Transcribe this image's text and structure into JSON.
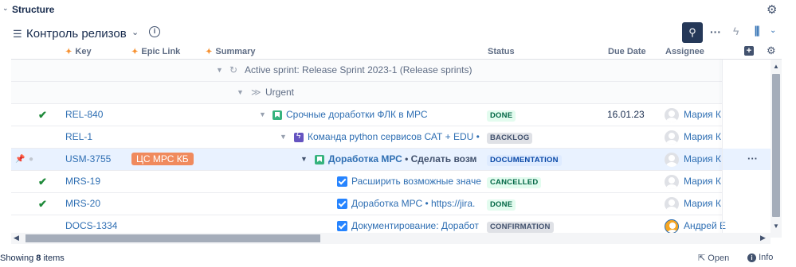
{
  "panel": {
    "title": "Structure"
  },
  "toolbar": {
    "structure_name": "Контроль релизов"
  },
  "columns": {
    "key": "Key",
    "epic": "Epic Link",
    "summary": "Summary",
    "status": "Status",
    "due": "Due Date",
    "assignee": "Assignee"
  },
  "groups": {
    "sprint": "Active sprint: Release Sprint 2023-1 (Release sprints)",
    "priority": "Urgent"
  },
  "rows": [
    {
      "key": "REL-840",
      "summary": "Срочные доработки ФЛК в МРС",
      "status": "DONE",
      "due": "16.01.23",
      "assignee": "Мария К"
    },
    {
      "key": "REL-1",
      "summary": "Команда python сервисов САТ + EDU •",
      "status": "BACKLOG",
      "assignee": "Мария К"
    },
    {
      "key": "USM-3755",
      "epic": "ЦС МРС КБ",
      "summary": "Доработка МРС",
      "summary_extra": "Сделать возм",
      "status": "DOCUMENTATION",
      "assignee": "Мария К"
    },
    {
      "key": "MRS-19",
      "summary": "Расширить возможные значе",
      "status": "CANCELLED",
      "assignee": "Мария К"
    },
    {
      "key": "MRS-20",
      "summary": "Доработка МРС • https://jira.",
      "status": "DONE",
      "assignee": "Мария К"
    },
    {
      "key": "DOCS-1334",
      "summary": "Документирование: Доработ",
      "status": "CONFIRMATION",
      "assignee": "Андрей Е"
    }
  ],
  "footer": {
    "showing_prefix": "Showing",
    "count": "8",
    "showing_suffix": "items",
    "open": "Open",
    "info": "Info"
  }
}
